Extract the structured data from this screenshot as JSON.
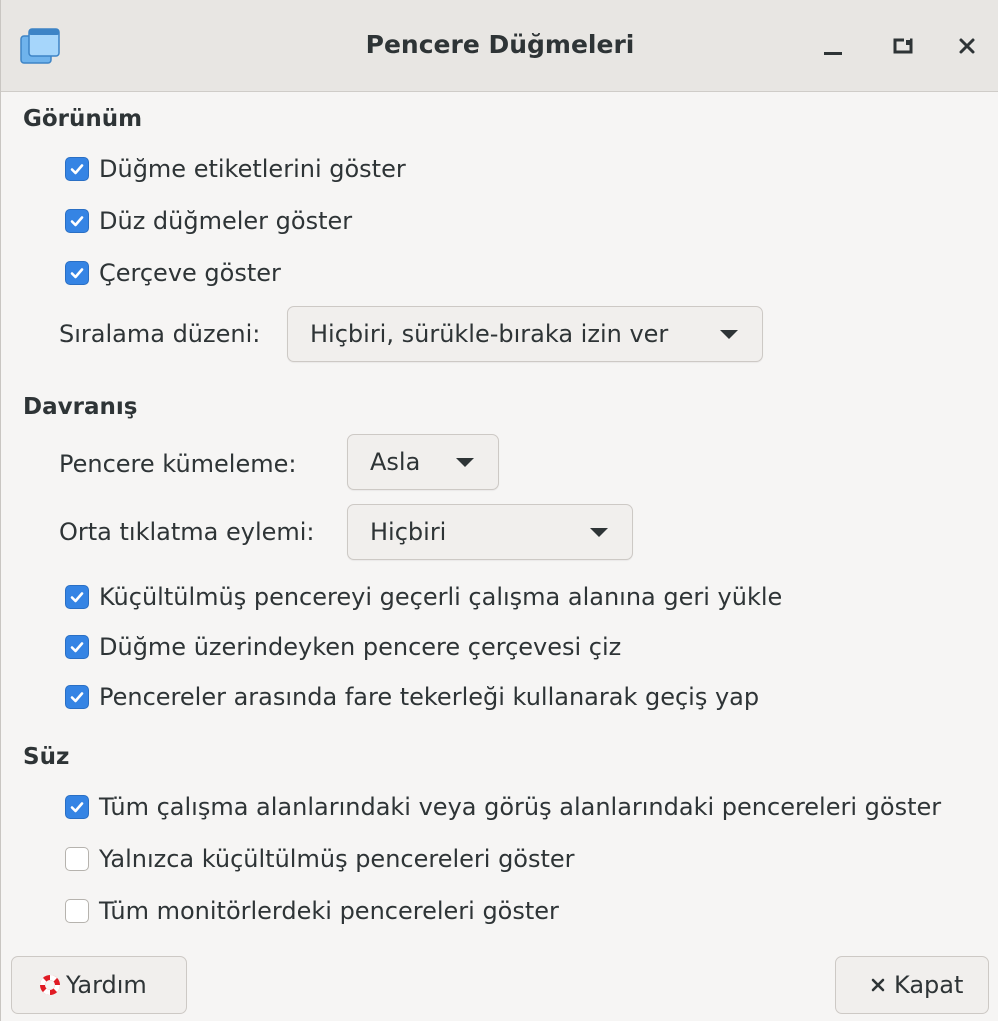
{
  "window": {
    "title": "Pencere Düğmeleri",
    "controls": [
      "minimize",
      "maximize",
      "close"
    ]
  },
  "appearance": {
    "heading": "Görünüm",
    "checks": [
      {
        "label": "Düğme etiketlerini göster",
        "checked": true
      },
      {
        "label": "Düz düğmeler göster",
        "checked": true
      },
      {
        "label": "Çerçeve göster",
        "checked": true
      }
    ],
    "sort_label": "Sıralama düzeni:",
    "sort_value": "Hiçbiri, sürükle-bıraka izin ver"
  },
  "behavior": {
    "heading": "Davranış",
    "grouping_label": "Pencere kümeleme:",
    "grouping_value": "Asla",
    "middle_click_label": "Orta tıklatma eylemi:",
    "middle_click_value": "Hiçbiri",
    "checks": [
      {
        "label": "Küçültülmüş pencereyi geçerli çalışma alanına geri yükle",
        "checked": true
      },
      {
        "label": "Düğme üzerindeyken pencere çerçevesi çiz",
        "checked": true
      },
      {
        "label": "Pencereler arasında fare tekerleği kullanarak geçiş yap",
        "checked": true
      }
    ]
  },
  "filter": {
    "heading": "Süz",
    "checks": [
      {
        "label": "Tüm çalışma alanlarındaki veya görüş alanlarındaki pencereleri göster",
        "checked": true
      },
      {
        "label": "Yalnızca küçültülmüş pencereleri göster",
        "checked": false
      },
      {
        "label": "Tüm monitörlerdeki pencereleri göster",
        "checked": false
      }
    ]
  },
  "buttons": {
    "help": "Yardım",
    "close": "Kapat"
  },
  "colors": {
    "accent": "#3584e4",
    "background": "#f6f5f4",
    "titlebar": "#e8e6e3"
  }
}
